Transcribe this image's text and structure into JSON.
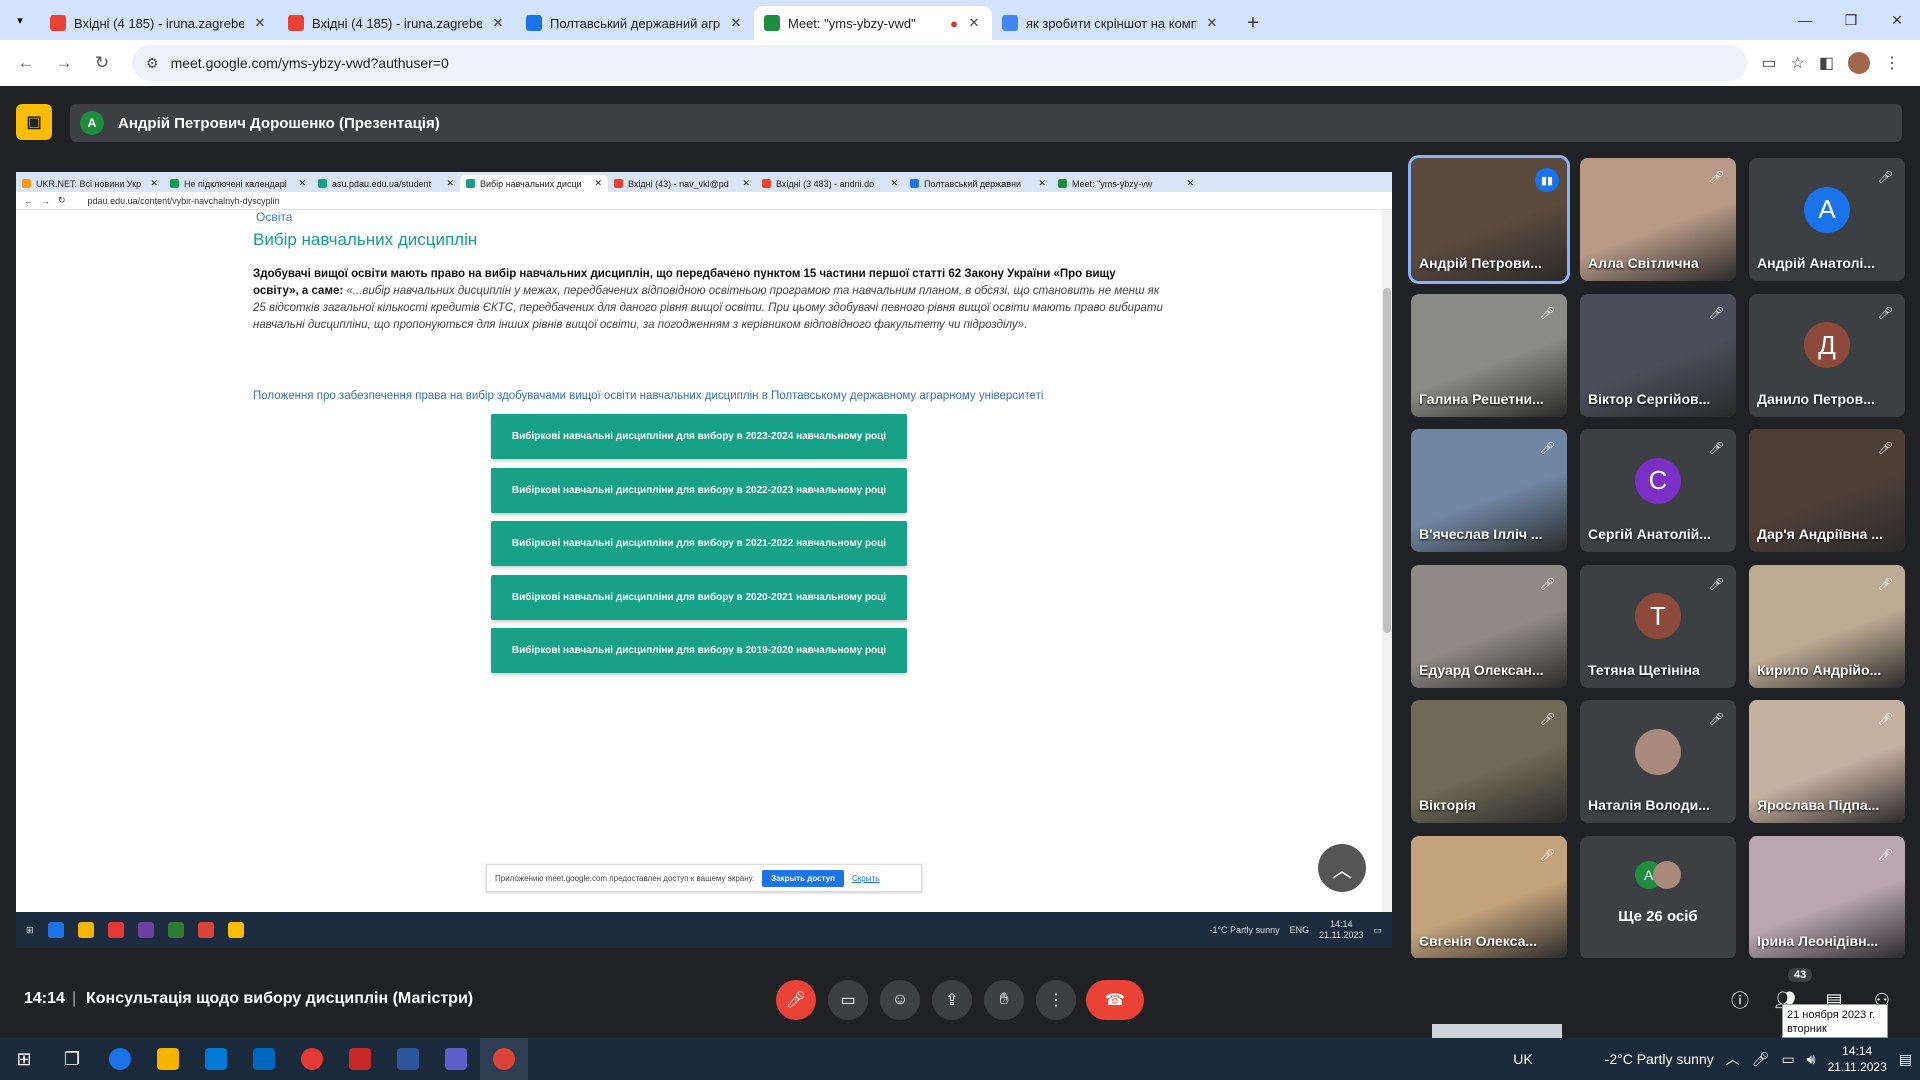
{
  "browser": {
    "tabs": [
      {
        "title": "Вхідні (4 185) - iruna.zagrebeln",
        "icon": "gmail-icon",
        "color": "#ea4335",
        "active": false
      },
      {
        "title": "Вхідні (4 185) - iruna.zagrebeln",
        "icon": "gmail-icon",
        "color": "#ea4335",
        "active": false
      },
      {
        "title": "Полтавський державний агра",
        "icon": "site-icon",
        "color": "#1a73e8",
        "active": false
      },
      {
        "title": "Meet: \"yms-ybzy-vwd\"",
        "icon": "meet-icon",
        "color": "#1e8e3e",
        "active": true
      },
      {
        "title": "як зробити скріншот на комп",
        "icon": "google-icon",
        "color": "#4285f4",
        "active": false
      }
    ],
    "url": "meet.google.com/yms-ybzy-vwd?authuser=0"
  },
  "presenter": {
    "initial": "A",
    "label": "Андрій Петрович Дорошенко (Презентація)"
  },
  "shared_screen": {
    "tabs": [
      {
        "title": "UKR.NET: Всі новини Укр",
        "color": "#f39c12"
      },
      {
        "title": "Не підключені календарі",
        "color": "#0f9d58"
      },
      {
        "title": "asu.pdau.edu.ua/student",
        "color": "#16a085"
      },
      {
        "title": "Вибір навчальних дисци",
        "color": "#16a085",
        "active": true
      },
      {
        "title": "Вхідні (43) - nav_vkl@pd",
        "color": "#ea4335"
      },
      {
        "title": "Вхідні (3 483) - andrii.do",
        "color": "#ea4335"
      },
      {
        "title": "Полтавський державни",
        "color": "#1a73e8"
      },
      {
        "title": "Meet: \"yms-ybzy-vw",
        "color": "#1e8e3e"
      }
    ],
    "url": "pdau.edu.ua/content/vybir-navchalnyh-dyscyplin",
    "breadcrumb": "Освіта",
    "page_title": "Вибір навчальних дисциплін",
    "paragraph_bold": "Здобувачі вищої освіти мають право на вибір навчальних дисциплін, що передбачено пунктом 15 частини першої статті 62 Закону України «Про вищу освіту», а саме:",
    "paragraph_italic": " «...вибір навчальних дисциплін у межах, передбачених відповідною освітньою програмою та навчальним планом, в обсязі, що становить не менш як 25 відсотків загальної кількості кредитів ЄКТС, передбачених для даного рівня вищої освіти. При цьому здобувачі певного рівня вищої освіти мають право вибирати навчальні дисципліни, що пропонуються для інших рівнів вищої освіти, за погодженням з керівником відповідного факультету чи підрозділу».",
    "link": "Положення про забезпечення права на вибір здобувачами вищої освіти навчальних дисциплін в Полтавському державному аграрному університеті",
    "buttons": [
      "Вибіркові навчальні дисципліни для вибору в 2023-2024 навчальному році",
      "Вибіркові навчальні дисципліни для вибору в 2022-2023 навчальному році",
      "Вибіркові навчальні дисципліни для вибору в 2021-2022 навчальному році",
      "Вибіркові навчальні дисципліни для вибору в 2020-2021 навчальному році",
      "Вибіркові навчальні дисципліни для вибору в 2019-2020 навчальному році"
    ],
    "share_note": "Приложению meet.google.com предоставлен доступ к вашему экрану.",
    "share_stop": "Закрыть доступ",
    "share_hide": "Скрыть",
    "taskbar": {
      "weather": "-1°C  Partly sunny",
      "lang": "ENG",
      "time": "14:14",
      "date": "21.11.2023"
    }
  },
  "participants": [
    {
      "name": "Андрій Петрови...",
      "type": "video",
      "bg": "#5b4a3e",
      "speaking": true
    },
    {
      "name": "Алла Світлична",
      "type": "video",
      "bg": "#b89a86"
    },
    {
      "name": "Андрій Анатолі...",
      "type": "initial",
      "initial": "A",
      "color": "#1a73e8"
    },
    {
      "name": "Галина Решетни...",
      "type": "video",
      "bg": "#8a8a86"
    },
    {
      "name": "Віктор Сергійов...",
      "type": "video",
      "bg": "#4a4e5a"
    },
    {
      "name": "Данило Петров...",
      "type": "initial",
      "initial": "Д",
      "color": "#8d4a3a"
    },
    {
      "name": "В'ячеслав Ілліч ...",
      "type": "video",
      "bg": "#6f87a3"
    },
    {
      "name": "Сергій Анатолій...",
      "type": "initial",
      "initial": "C",
      "color": "#7b2fc4"
    },
    {
      "name": "Дар'я Андріївна ...",
      "type": "video",
      "bg": "#4e3f36"
    },
    {
      "name": "Едуард Олексан...",
      "type": "video",
      "bg": "#8f8a84"
    },
    {
      "name": "Тетяна Щетініна",
      "type": "initial",
      "initial": "T",
      "color": "#8d4a3a"
    },
    {
      "name": "Кирило Андрійо...",
      "type": "video",
      "bg": "#bdaa93"
    },
    {
      "name": "Вікторія",
      "type": "video",
      "bg": "#6f6a55"
    },
    {
      "name": "Наталія Володи...",
      "type": "avatar",
      "bg": "#a98a7c"
    },
    {
      "name": "Ярослава Підпа...",
      "type": "video",
      "bg": "#c7b0a0"
    },
    {
      "name": "Євгенія Олекса...",
      "type": "video",
      "bg": "#c4a37c"
    },
    {
      "name": "Ще 26 осіб",
      "type": "more",
      "initial": "A",
      "color": "#1e8e3e"
    },
    {
      "name": "Ірина Леонідівн...",
      "type": "video",
      "bg": "#b9a6b0"
    }
  ],
  "meeting": {
    "time": "14:14",
    "title": "Консультація щодо вибору дисциплін (Магістри)",
    "participants_count": "43",
    "tooltip_date": "21 ноября 2023 г.",
    "tooltip_day": "вторник"
  },
  "windows_taskbar": {
    "lang": "UK",
    "weather": "-2°C  Partly sunny",
    "time": "14:14",
    "date": "21.11.2023"
  }
}
